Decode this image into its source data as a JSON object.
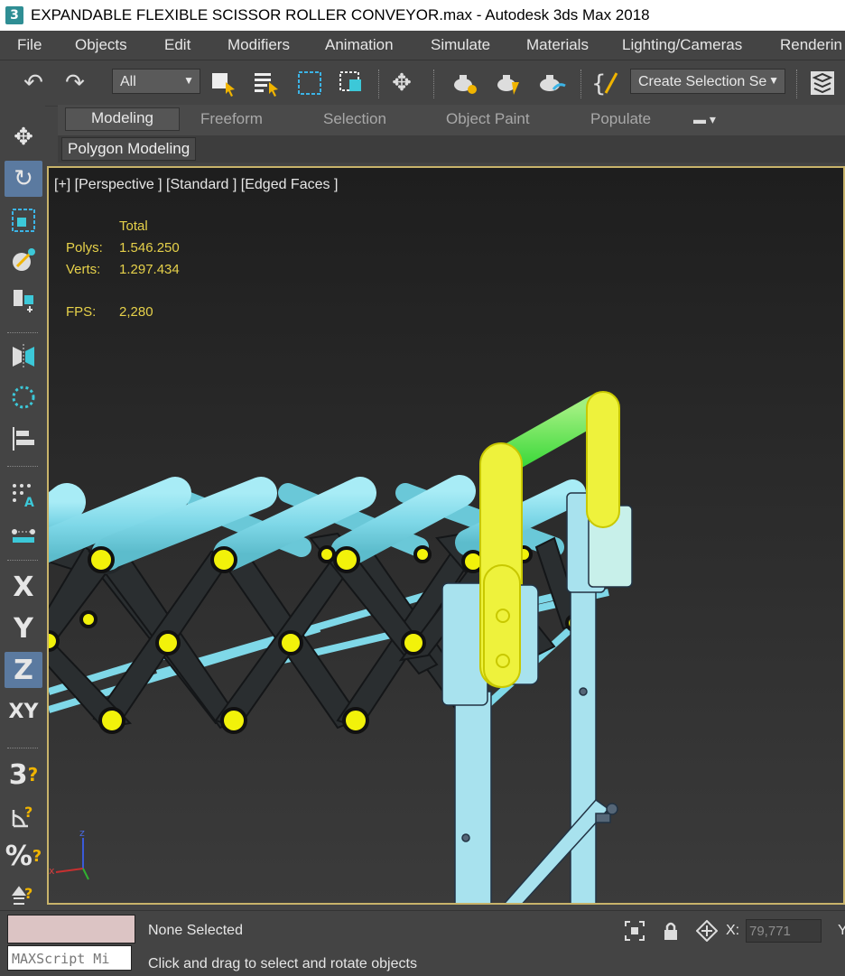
{
  "window": {
    "app_icon": "3",
    "title": "EXPANDABLE FLEXIBLE SCISSOR ROLLER CONVEYOR.max - Autodesk 3ds Max 2018"
  },
  "menu": [
    "File",
    "Objects",
    "Edit",
    "Modifiers",
    "Animation",
    "Simulate",
    "Materials",
    "Lighting/Cameras",
    "Renderin"
  ],
  "toolbar": {
    "filter_value": "All",
    "selection_set_placeholder": "Create Selection Se",
    "icons": [
      "undo-icon",
      "redo-icon",
      "select-object-icon",
      "select-by-name-icon",
      "rectangular-selection-icon",
      "window-crossing-icon",
      "select-and-move-icon",
      "render-setup-icon",
      "rendered-frame-icon",
      "render-icon",
      "edit-named-selection-icon",
      "scene-explorer-icon"
    ]
  },
  "ribbon": {
    "tabs": [
      "Modeling",
      "Freeform",
      "Selection",
      "Object Paint",
      "Populate"
    ],
    "active_tab": "Modeling",
    "panel_label": "Polygon Modeling"
  },
  "left_toolbar": {
    "axis_x": "X",
    "axis_y": "Y",
    "axis_z": "Z",
    "axis_xy": "XY",
    "snap_3d": "3",
    "percent_snap": "%"
  },
  "viewport": {
    "label": "[+] [Perspective ] [Standard ] [Edged Faces ]",
    "stats_header": "Total",
    "polys_label": "Polys:",
    "polys_value": "1.546.250",
    "verts_label": "Verts:",
    "verts_value": "1.297.434",
    "fps_label": "FPS:",
    "fps_value": "2,280",
    "gizmo_z": "z",
    "gizmo_x": "x",
    "colors": {
      "roller": "#7fd8e8",
      "scissor": "#2a2e30",
      "pin": "#f2f20a",
      "selected_frame": "#e8f23a",
      "green_bar": "#4fe04a",
      "leg": "#a8e2ee"
    }
  },
  "status": {
    "maxscript": "MAXScript Mi",
    "selection": "None Selected",
    "hint": "Click and drag to select and rotate objects",
    "x_label": "X:",
    "x_value": "79,771",
    "y_label": "Y"
  }
}
